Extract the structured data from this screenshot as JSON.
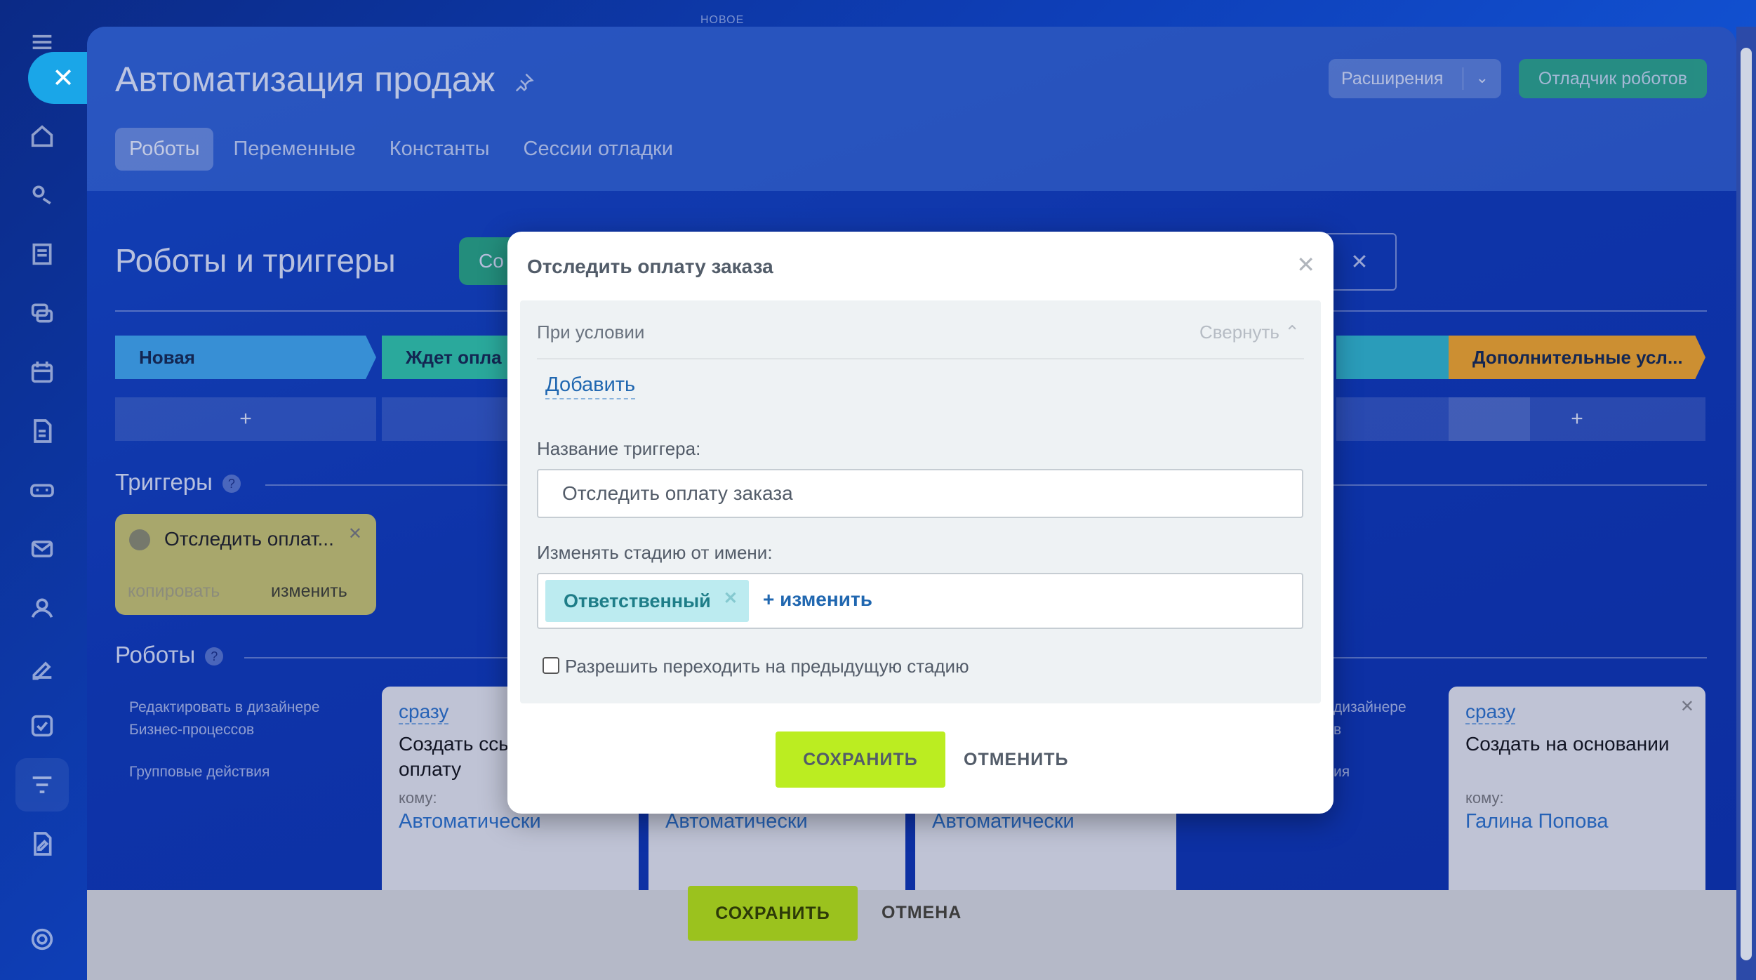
{
  "top_note": "НОВОЕ",
  "header": {
    "title": "Автоматизация продаж",
    "extensions_label": "Расширения",
    "debugger_label": "Отладчик роботов",
    "tabs": [
      {
        "label": "Роботы",
        "active": true
      },
      {
        "label": "Переменные",
        "active": false
      },
      {
        "label": "Константы",
        "active": false
      },
      {
        "label": "Сессии отладки",
        "active": false
      }
    ]
  },
  "main": {
    "section_title": "Роботы и триггеры",
    "green_button_partial": "Со",
    "stages": [
      {
        "label": "Новая",
        "color": "#3fa7ea"
      },
      {
        "label": "Ждет опла",
        "color": "#2fc6a4"
      },
      {
        "label": "Дополнительные усл...",
        "color": "#f5a623"
      }
    ],
    "stage_add": "+",
    "triggers_title": "Триггеры",
    "help_glyph": "?",
    "trigger_card": {
      "label": "Отследить оплат...",
      "copy": "копировать",
      "edit": "изменить"
    },
    "robots_title": "Роботы",
    "side_links": {
      "edit_in_designer": "Редактировать в дизайнере Бизнес-процессов",
      "group_actions": "Групповые действия",
      "partial_right_1": "дизайнере",
      "partial_right_2": "в",
      "partial_right_3": "ия"
    },
    "robot_cards": [
      {
        "when": "сразу",
        "name": "Создать ссы оплату",
        "to": "кому:",
        "who": "Автоматически"
      },
      {
        "who": "Автоматически"
      },
      {
        "who": "Автоматически"
      },
      {
        "when": "сразу",
        "name": "Создать на основании",
        "to": "кому:",
        "who": "Галина Попова"
      }
    ]
  },
  "footer": {
    "save": "СОХРАНИТЬ",
    "cancel": "ОТМЕНА"
  },
  "dialog": {
    "title": "Отследить оплату заказа",
    "condition_label": "При условии",
    "collapse_label": "Свернуть",
    "add_link": "Добавить",
    "trigger_name_label": "Название триггера:",
    "trigger_name_value": "Отследить оплату заказа",
    "change_stage_label": "Изменять стадию от имени:",
    "responsible_tag": "Ответственный",
    "change_link": "+ изменить",
    "allow_prev_label": "Разрешить переходить на предыдущую стадию",
    "save": "СОХРАНИТЬ",
    "cancel": "ОТМЕНИТЬ"
  }
}
